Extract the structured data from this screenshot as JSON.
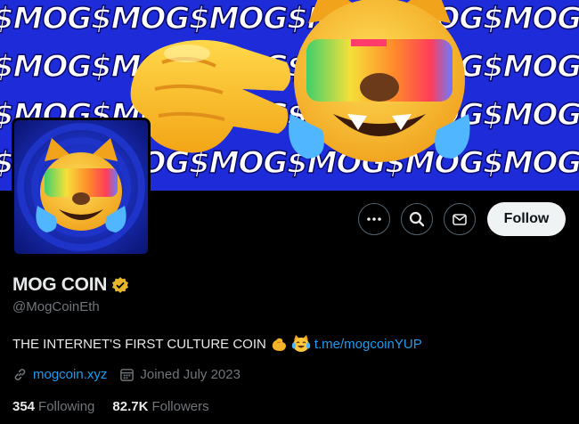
{
  "banner": {
    "tile_text": "$MOG",
    "background": "#1d2bd8"
  },
  "profile": {
    "display_name": "MOG COIN",
    "verified_badge": "gold-verified-badge-icon",
    "handle": "@MogCoinEth",
    "bio_text": "THE INTERNET'S FIRST CULTURE COIN",
    "bio_emojis": [
      "flexed-biceps-icon",
      "cat-tears-of-joy-icon"
    ],
    "bio_link": "t.me/mogcoinYUP",
    "website": "mogcoin.xyz",
    "joined": "Joined July 2023",
    "following_count": "354",
    "following_label": "Following",
    "followers_count": "82.7K",
    "followers_label": "Followers"
  },
  "actions": {
    "more_icon": "more-icon",
    "search_icon": "search-icon",
    "message_icon": "message-icon",
    "follow_label": "Follow"
  },
  "colors": {
    "accent_link": "#1d9bf0",
    "muted_text": "#71767b",
    "gold_badge": "#e8b62a"
  }
}
